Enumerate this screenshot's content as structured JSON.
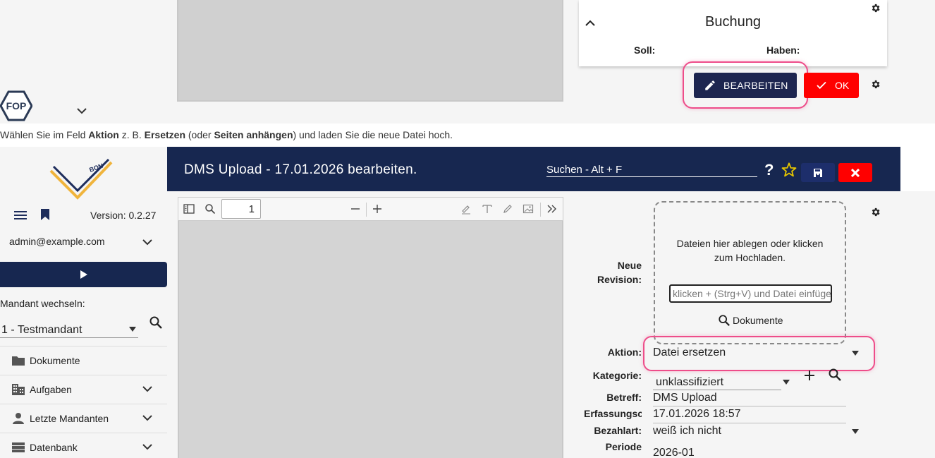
{
  "top": {
    "card_title": "Buchung",
    "soll_label": "Soll:",
    "haben_label": "Haben:",
    "edit_button": "BEARBEITEN",
    "ok_button": "OK",
    "logo_text": "FOP"
  },
  "instruction": {
    "parts": [
      "Wählen Sie im Feld ",
      "Aktion",
      " z. B. ",
      "Ersetzen",
      " (oder ",
      "Seiten anhängen",
      ") und laden Sie die neue Datei hoch."
    ]
  },
  "sidebar": {
    "logo_text": "BON",
    "version": "Version: 0.2.27",
    "user": "admin@example.com",
    "mandant_label": "Mandant wechseln:",
    "mandant_value": "1 - Testmandant",
    "items": [
      {
        "label": "Dokumente",
        "icon": "folder-icon"
      },
      {
        "label": "Aufgaben",
        "icon": "building-icon"
      },
      {
        "label": "Letzte Mandanten",
        "icon": "person-icon"
      },
      {
        "label": "Datenbank",
        "icon": "list-icon"
      }
    ]
  },
  "header": {
    "title": "DMS Upload - 17.01.2026 bearbeiten.",
    "search_placeholder": "Suchen - Alt + F",
    "help": "?"
  },
  "pdf": {
    "page_number": "1"
  },
  "form": {
    "upload_text": "Dateien hier ablegen oder klicken zum Hochladen.",
    "paste_placeholder": "klicken + (Strg+V) und Datei einfügen",
    "documents_link": "Dokumente",
    "neue_revision_label": "Neue Revision:",
    "aktion_label": "Aktion:",
    "aktion_value": "Datei ersetzen",
    "kategorie_label": "Kategorie:",
    "kategorie_value": "unklassifiziert",
    "betreff_label": "Betreff:",
    "betreff_value": "DMS Upload",
    "erfassung_label": "Erfassungsc",
    "erfassung_value": "17.01.2026 18:57",
    "bezahlart_label": "Bezahlart:",
    "bezahlart_value": "weiß ich nicht",
    "periode_label": "Periode",
    "periode_value": "2026-01"
  },
  "colors": {
    "navy": "#172750",
    "button_dark": "#1d2650",
    "red": "#ff0000",
    "highlight": "#ee4d8a",
    "star": "#e6c600"
  }
}
